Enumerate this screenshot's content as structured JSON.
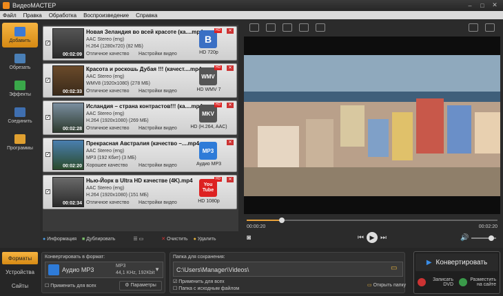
{
  "window": {
    "title": "ВидеоМАСТЕР"
  },
  "menu": [
    "Файл",
    "Правка",
    "Обработка",
    "Воспроизведение",
    "Справка"
  ],
  "sidebar": [
    {
      "label": "Добавить",
      "icon": "add-file-icon",
      "active": true
    },
    {
      "label": "Обрезать",
      "icon": "cut-film-icon",
      "active": false
    },
    {
      "label": "Эффекты",
      "icon": "effects-icon",
      "active": false
    },
    {
      "label": "Соединить",
      "icon": "join-icon",
      "active": false
    },
    {
      "label": "Программы",
      "icon": "programs-icon",
      "active": false
    }
  ],
  "files": [
    {
      "name": "Новая Зеландия во всей красоте (ка....mp4",
      "audio": "AAC Stereo (eng)",
      "video": "H.264 (1280x720) (82 МБ)",
      "quality": "Отличное качество",
      "settings": "Настройки видео",
      "duration": "00:02:09",
      "format_icon": "B",
      "format_label": "HD 720p",
      "format_color": "#3a6fc4"
    },
    {
      "name": "Красота и роскошь Дубая !!! (качест....mp4",
      "audio": "AAC Stereo (eng)",
      "video": "WMV8 (1920x1080) (278 МБ)",
      "quality": "Отличное качество",
      "settings": "Настройки видео",
      "duration": "00:02:33",
      "format_icon": "WMV",
      "format_label": "HD WMV 7",
      "format_color": "#555"
    },
    {
      "name": "Исландия – страна контрастов!!! (ка....mp4",
      "audio": "AAC Stereo (eng)",
      "video": "H.264 (1920x1080) (269 МБ)",
      "quality": "Отличное качество",
      "settings": "Настройки видео",
      "duration": "00:02:28",
      "format_icon": "MKV",
      "format_label": "HD (H.264, AAC)",
      "format_color": "#555"
    },
    {
      "name": "Прекрасная Австралия (качество –....mp4",
      "audio": "AAC Stereo (eng)",
      "video": "MP3 (192 Кбит) (3 МБ)",
      "quality": "Хорошее качество",
      "settings": "Настройки видео",
      "duration": "00:02:20",
      "format_icon": "MP3",
      "format_label": "Аудио MP3",
      "format_color": "#2e7bd8"
    },
    {
      "name": "Нью-Йорк в Ultra HD качестве (4K).mp4",
      "audio": "AAC Stereo (eng)",
      "video": "H.264 (1920x1080) (151 МБ)",
      "quality": "Отличное качество",
      "settings": "Настройки видео",
      "duration": "00:02:34",
      "format_icon": "You Tube",
      "format_label": "HD 1080p",
      "format_color": "#d22"
    }
  ],
  "listbar": {
    "info": "Информация",
    "duplicate": "Дублировать",
    "clear": "Очистить",
    "delete": "Удалить"
  },
  "player": {
    "time_current": "00:00:20",
    "time_total": "00:02:20",
    "progress": 0.14,
    "volume": 0.8
  },
  "bottom_tabs": [
    "Форматы",
    "Устройства",
    "Сайты"
  ],
  "format_panel": {
    "label": "Конвертировать в формат:",
    "format_name": "Аудио MP3",
    "format_detail_1": "MP3",
    "format_detail_2": "44,1 KHz, 192Kbit",
    "apply_all": "Применить для всех",
    "params": "Параметры"
  },
  "save_panel": {
    "label": "Папка для сохранения:",
    "path": "C:\\Users\\Manager\\Videos\\",
    "apply_all": "Применить для всех",
    "source_folder": "Папка с исходным файлом",
    "open_folder": "Открыть папку"
  },
  "convert": {
    "label": "Конвертировать",
    "dvd": "Записать DVD",
    "web": "Разместить на сайте"
  }
}
